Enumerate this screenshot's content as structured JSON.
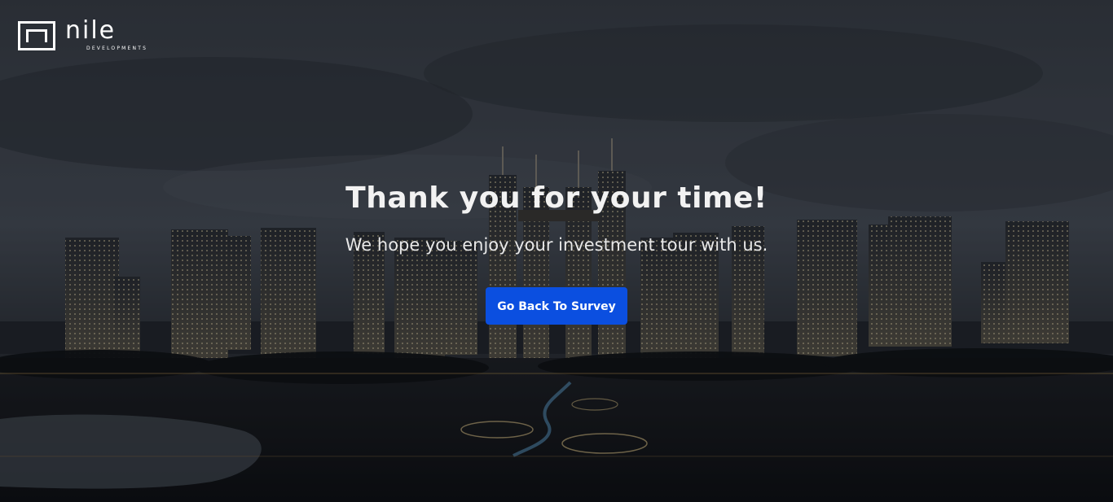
{
  "brand": {
    "name": "nile",
    "tagline": "DEVELOPMENTS"
  },
  "hero": {
    "title": "Thank you for your time!",
    "subtitle": "We hope you enjoy your investment tour with us.",
    "button_label": "Go Back To Survey"
  },
  "colors": {
    "accent": "#0b4fe0",
    "text": "#f2f2f2",
    "sky": "#3a3f47",
    "ground": "#121416"
  }
}
